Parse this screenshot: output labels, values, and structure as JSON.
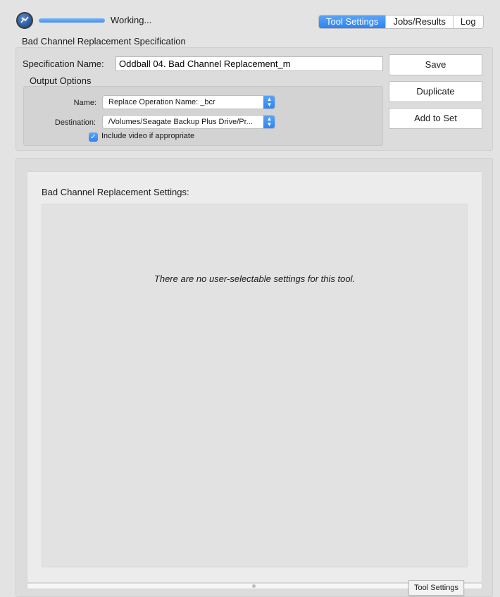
{
  "status": {
    "label": "Working...",
    "progress": 1.0
  },
  "tabs": [
    {
      "label": "Tool Settings",
      "active": true
    },
    {
      "label": "Jobs/Results",
      "active": false
    },
    {
      "label": "Log",
      "active": false
    }
  ],
  "spec": {
    "section_title": "Bad Channel Replacement Specification",
    "name_label": "Specification Name:",
    "name_value": "Oddball 04. Bad Channel Replacement_m"
  },
  "output_options": {
    "title": "Output Options",
    "name_label": "Name:",
    "name_value": "Replace Operation Name: _bcr",
    "destination_label": "Destination:",
    "destination_value": "/Volumes/Seagate Backup Plus Drive/Pr...",
    "include_video_label": "Include video if appropriate",
    "include_video_checked": true
  },
  "buttons": {
    "save": "Save",
    "duplicate": "Duplicate",
    "add_to_set": "Add to Set"
  },
  "settings": {
    "title": "Bad Channel Replacement Settings:",
    "empty_message": "There are no user-selectable settings for this tool."
  },
  "tooltip": "Tool Settings",
  "colors": {
    "accent": "#2e83f0",
    "background": "#e3e3e3"
  }
}
